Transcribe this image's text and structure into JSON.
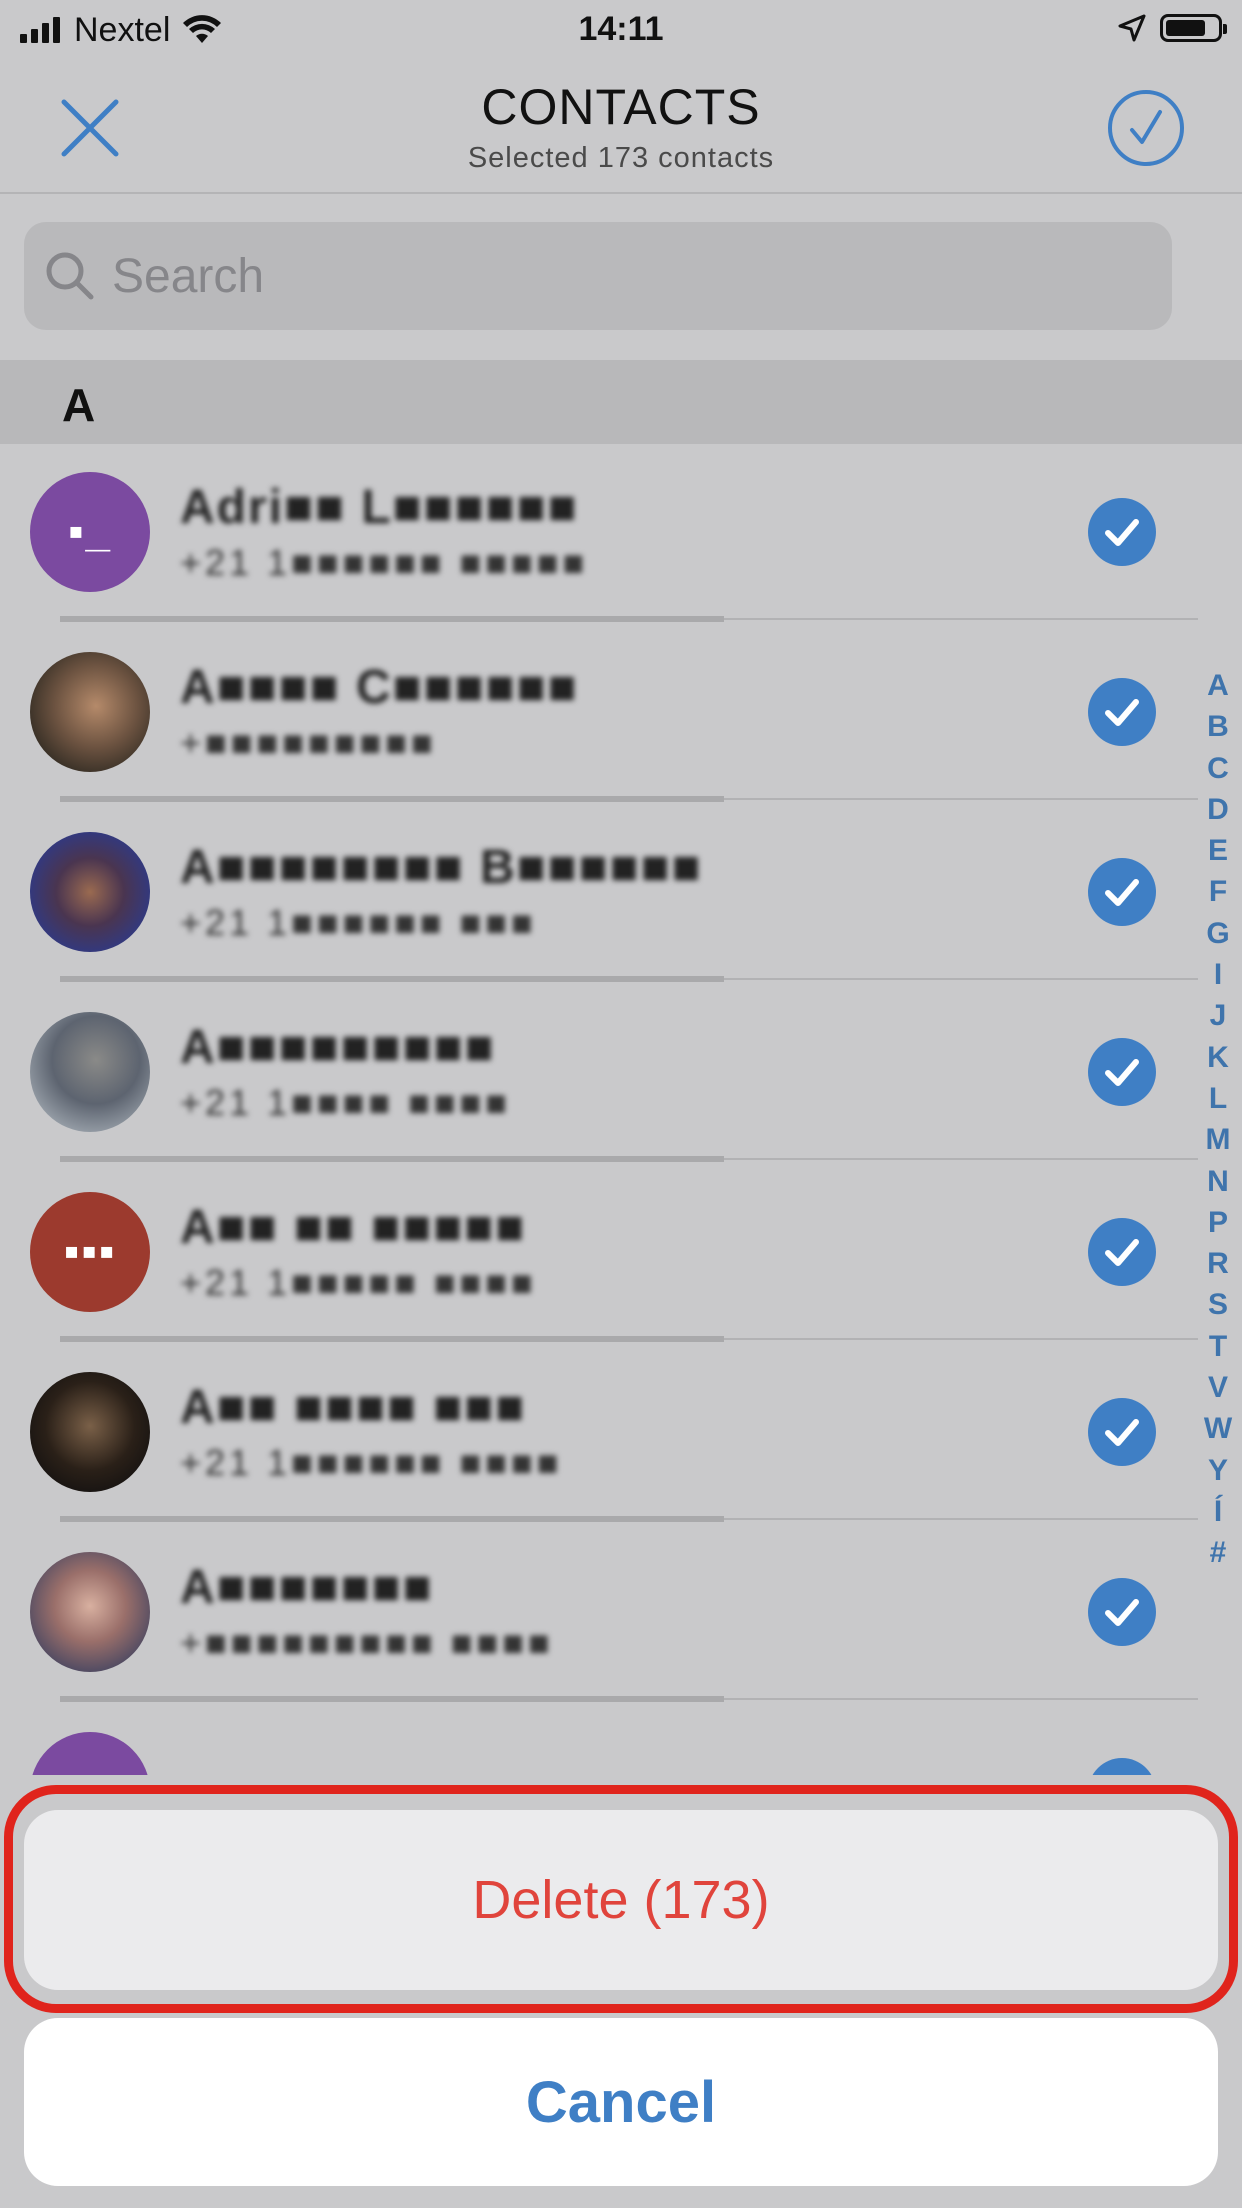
{
  "status_bar": {
    "carrier": "Nextel",
    "time": "14:11"
  },
  "navbar": {
    "title": "CONTACTS",
    "subtitle": "Selected 173 contacts"
  },
  "search": {
    "placeholder": "Search"
  },
  "section": {
    "letter": "A"
  },
  "contacts": [
    {
      "name": "Adri■■ L■■■■■■",
      "phone": "+21 1■■■■■■ ■■■■■",
      "selected": true
    },
    {
      "name": "A■■■■ C■■■■■■",
      "phone": "+■■■■■■■■■",
      "selected": true
    },
    {
      "name": "A■■■■■■■■ B■■■■■■",
      "phone": "+21 1■■■■■■ ■■■",
      "selected": true
    },
    {
      "name": "A■■■■■■■■■",
      "phone": "+21 1■■■■ ■■■■",
      "selected": true
    },
    {
      "name": "A■■ ■■ ■■■■■",
      "phone": "+21 1■■■■■ ■■■■",
      "selected": true
    },
    {
      "name": "A■■ ■■■■ ■■■",
      "phone": "+21 1■■■■■■ ■■■■",
      "selected": true
    },
    {
      "name": "A■■■■■■■",
      "phone": "+■■■■■■■■■ ■■■■",
      "selected": true
    }
  ],
  "index_letters": [
    "A",
    "B",
    "C",
    "D",
    "E",
    "F",
    "G",
    "I",
    "J",
    "K",
    "L",
    "M",
    "N",
    "P",
    "R",
    "S",
    "T",
    "V",
    "W",
    "Y",
    "Í",
    "#"
  ],
  "action_sheet": {
    "delete_label": "Delete (173)",
    "cancel_label": "Cancel"
  },
  "colors": {
    "accent": "#3f7fc5",
    "destructive": "#e0443c",
    "highlight": "#e0241c",
    "avatar_purple": "#7b4aa0",
    "avatar_red": "#9c3a2e"
  },
  "icons": [
    "signal-icon",
    "wifi-icon",
    "location-icon",
    "battery-icon",
    "close-icon",
    "checkmark-circle-icon",
    "search-icon",
    "check-circle-icon"
  ]
}
